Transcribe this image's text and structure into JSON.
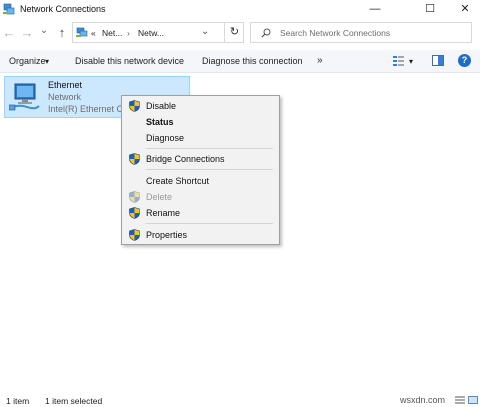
{
  "window": {
    "title": "Network Connections",
    "minimize_glyph": "—",
    "maximize_glyph": "☐",
    "close_glyph": "✕"
  },
  "nav": {
    "back_glyph": "←",
    "forward_glyph": "→",
    "dropdown_glyph": "⌄",
    "up_glyph": "↑",
    "refresh_glyph": "↻",
    "breadcrumb": {
      "overflow": "«",
      "segment_1": "Net...",
      "separator_glyph": "›",
      "segment_2": "Netw...",
      "dropdown_glyph": "⌄"
    },
    "search_placeholder": "Search Network Connections"
  },
  "commandbar": {
    "organize": "Organize",
    "organize_arrow": "▾",
    "disable_device": "Disable this network device",
    "diagnose": "Diagnose this connection",
    "more": "»",
    "view_arrow": "▾",
    "help": "?"
  },
  "item": {
    "name": "Ethernet",
    "type": "Network",
    "adapter": "Intel(R) Ethernet Co"
  },
  "context_menu": {
    "disable": "Disable",
    "status": "Status",
    "diagnose": "Diagnose",
    "bridge": "Bridge Connections",
    "create_shortcut": "Create Shortcut",
    "delete": "Delete",
    "rename": "Rename",
    "properties": "Properties"
  },
  "statusbar": {
    "item_count": "1 item",
    "selected": "1 item selected"
  },
  "watermark": "wsxdn.com",
  "colors": {
    "selection_fill": "#cce8ff",
    "selection_border": "#99d1ff",
    "help_blue": "#1c6fc6",
    "shield_blue": "#1f5fb5",
    "shield_yellow": "#f5c518"
  }
}
